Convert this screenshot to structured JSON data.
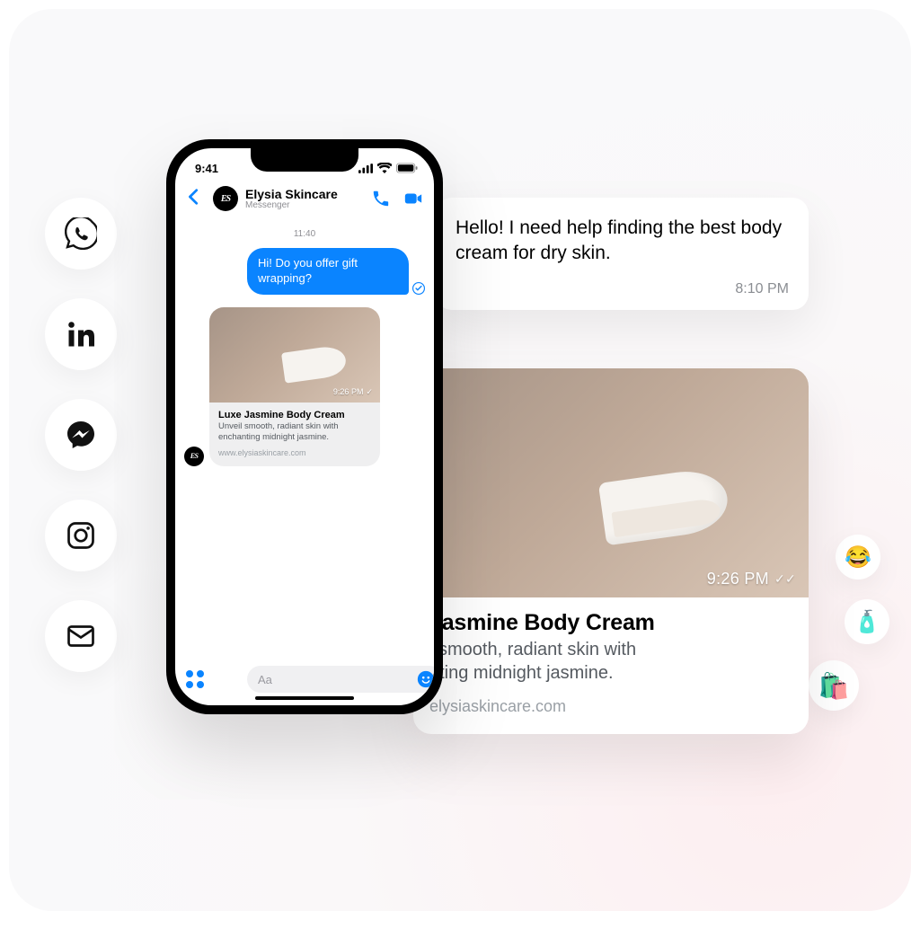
{
  "channel_icons": [
    "whatsapp",
    "linkedin",
    "messenger",
    "instagram",
    "mail"
  ],
  "emoji_bubbles": [
    "😂",
    "🧴",
    "🛍️"
  ],
  "status": {
    "time": "9:41"
  },
  "brand": {
    "name": "Elysia Skincare",
    "subtitle": "Messenger",
    "logo_text": "ES"
  },
  "thread": {
    "timestamp": "11:40",
    "outgoing": "Hi! Do you offer gift wrapping?"
  },
  "product_card": {
    "title": "Luxe Jasmine Body Cream",
    "desc": "Unveil smooth, radiant skin with enchanting midnight jasmine.",
    "site": "www.elysiaskincare.com",
    "stamp_time": "9:26 PM",
    "stamp_ticks": "✓"
  },
  "composer": {
    "placeholder": "Aa"
  },
  "float_message": {
    "text": "Hello! I need help finding the best body cream for dry skin.",
    "time": "8:10 PM"
  },
  "float_card": {
    "title": "Jasmine Body Cream",
    "desc_line1": "l smooth, radiant skin with",
    "desc_line2": "nting midnight jasmine.",
    "site": "elysiaskincare.com",
    "stamp_time": "9:26 PM",
    "stamp_ticks": "✓✓"
  }
}
